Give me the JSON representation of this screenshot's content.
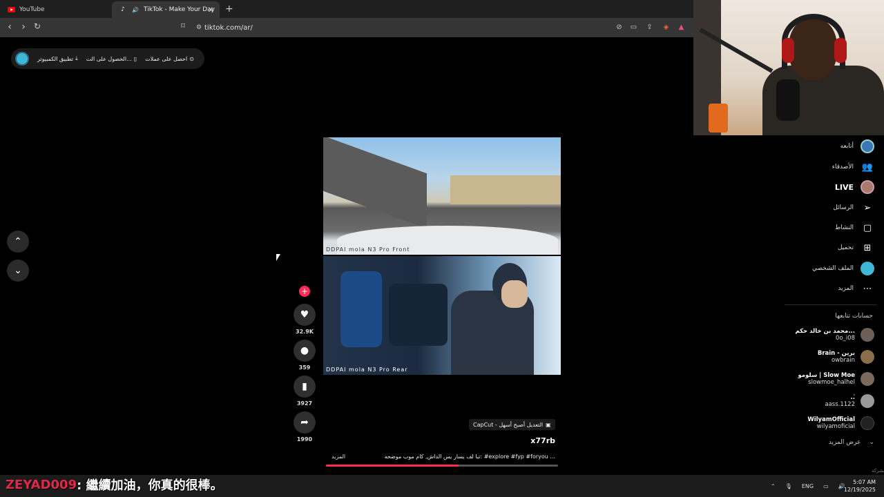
{
  "browser": {
    "tabs": [
      {
        "label": "YouTube",
        "icon": "youtube-icon"
      },
      {
        "label": "TikTok - Make Your Day",
        "icon": "tiktok-icon"
      }
    ],
    "new_tab_icon": "+",
    "close_icon": "✕",
    "url": "tiktok.com/ar/"
  },
  "tiktok_header": {
    "get_coins": "احصل على عملات",
    "get_app": "الحصول على الت...",
    "pc_app": "تطبيق الكمبيوتر"
  },
  "video": {
    "front_label": "DDPAI mola N3 Pro Front",
    "rear_label": "DDPAI mola N3 Pro Rear",
    "progress": 0.57
  },
  "actions": {
    "likes": "32.9K",
    "comments": "359",
    "saves": "3927",
    "shares": "1990"
  },
  "caption": {
    "capcut": "CapCut - التعديل أصبح أسهل",
    "author": "x77rb",
    "description": "تبا لف يسار يس الداش, كام موب موضحه: #explore #fyp #foryou ...",
    "more": "المزيد"
  },
  "sidebar": {
    "nav": [
      {
        "label": "أتابعه",
        "icon": "following-avatar-icon"
      },
      {
        "label": "الأصدقاء",
        "icon": "friends-icon"
      },
      {
        "label": "LIVE",
        "icon": "live-avatar-icon"
      },
      {
        "label": "الرسائل",
        "icon": "messages-icon"
      },
      {
        "label": "النشاط",
        "icon": "activity-icon"
      },
      {
        "label": "تحميل",
        "icon": "upload-icon"
      },
      {
        "label": "الملف الشخصي",
        "icon": "profile-icon"
      },
      {
        "label": "المزيد",
        "icon": "more-icon"
      }
    ],
    "followed_title": "حسابات تتابعها",
    "followed": [
      {
        "name": "محمد بن خالد حكم...",
        "handle": "0o_i08"
      },
      {
        "name": "Brain - برين",
        "handle": "owbrain"
      },
      {
        "name": "سلومو | Slow Moe",
        "handle": "slowmoe_halhel"
      },
      {
        "name": "..ٰ",
        "handle": "aass.1122"
      },
      {
        "name": "WilyamOfficial",
        "handle": "wilyamoficial"
      }
    ],
    "see_more": "عرض المزيد",
    "company": "الشركة"
  },
  "stream_overlay": {
    "subtitle_user": "ZEYAD009",
    "subtitle_text": ": 繼續加油，你真的很棒。"
  },
  "taskbar": {
    "lang": "ENG",
    "time": "5:07 AM",
    "date": "12/19/2025"
  },
  "colors": {
    "accent": "#fe2c55",
    "background": "#000000"
  }
}
